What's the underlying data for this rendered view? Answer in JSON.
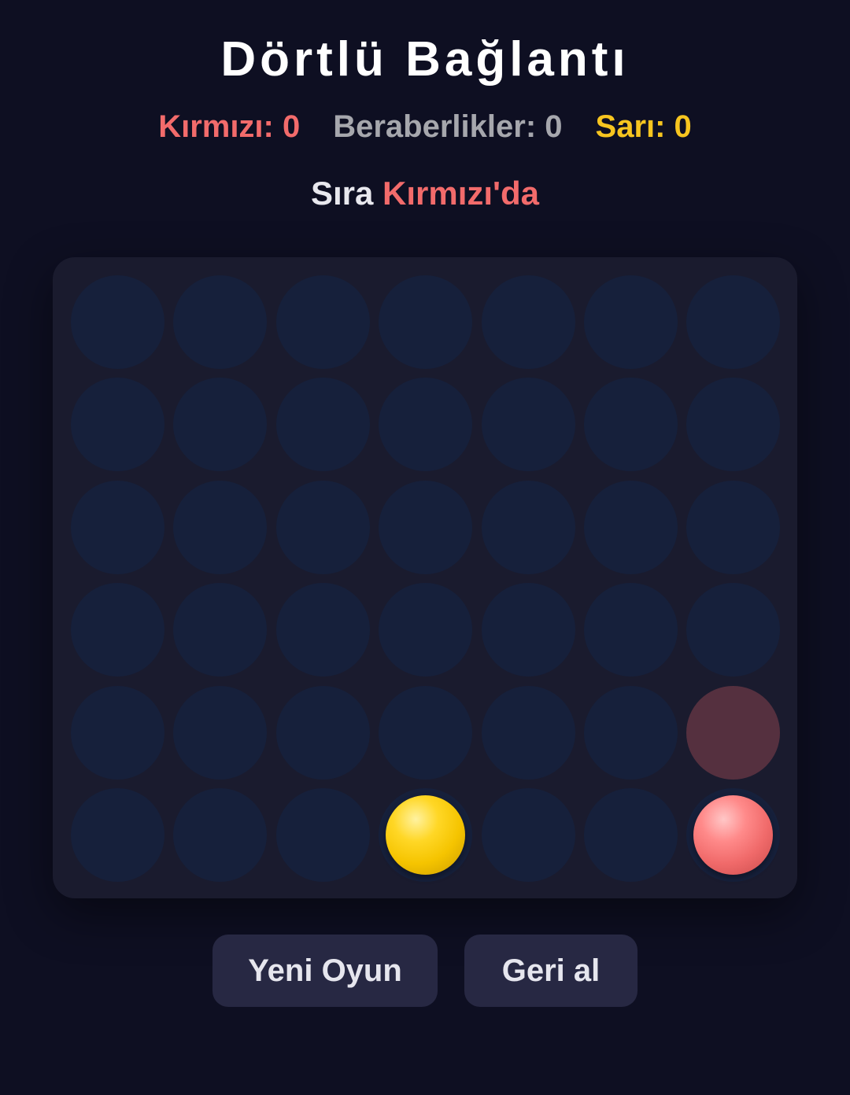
{
  "title": "Dörtlü Bağlantı",
  "scores": {
    "red": "Kırmızı: 0",
    "draws": "Beraberlikler: 0",
    "yellow": "Sarı: 0"
  },
  "turn": {
    "prefix": "Sıra ",
    "player": "Kırmızı'da"
  },
  "board": {
    "rows": 6,
    "columns": 7,
    "cells": [
      [
        "empty",
        "empty",
        "empty",
        "empty",
        "empty",
        "empty",
        "empty"
      ],
      [
        "empty",
        "empty",
        "empty",
        "empty",
        "empty",
        "empty",
        "empty"
      ],
      [
        "empty",
        "empty",
        "empty",
        "empty",
        "empty",
        "empty",
        "empty"
      ],
      [
        "empty",
        "empty",
        "empty",
        "empty",
        "empty",
        "empty",
        "empty"
      ],
      [
        "empty",
        "empty",
        "empty",
        "empty",
        "empty",
        "empty",
        "ghost-red"
      ],
      [
        "empty",
        "empty",
        "empty",
        "yellow",
        "empty",
        "empty",
        "red"
      ]
    ]
  },
  "buttons": {
    "new_game": "Yeni Oyun",
    "undo": "Geri al"
  },
  "colors": {
    "background": "#0e0f22",
    "board": "#1a1b2e",
    "empty_cell": "#16203b",
    "red": "#f26b6b",
    "yellow": "#f7c51f",
    "draw": "#a6a7ad",
    "button": "#272843"
  }
}
